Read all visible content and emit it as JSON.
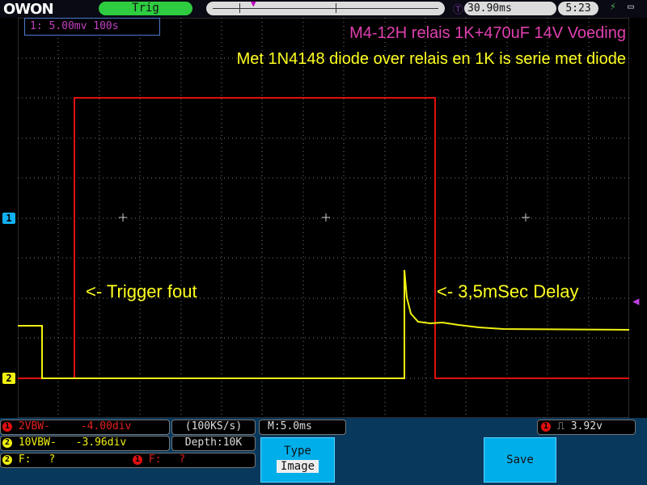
{
  "topbar": {
    "logo": "OWON",
    "trigger_state": "Trig",
    "trigger_time": "30.90ms",
    "clock": "5:23"
  },
  "info_box": "1: 5.00mv 100s",
  "notes": {
    "title": "M4-12H relais 1K+470uF 14V Voeding",
    "subtitle": "Met 1N4148 diode over relais en 1K is serie met diode"
  },
  "annotations": {
    "trigger_fout": "<- Trigger fout",
    "delay": "<- 3,5mSec Delay"
  },
  "channels": {
    "ch1_marker": "1",
    "ch2_marker": "2",
    "ch1_color": "#e01010",
    "ch2_color": "#f0f010"
  },
  "bottom": {
    "ch1_scale": "2VBW-",
    "ch1_offset": "-4.00div",
    "ch2_scale": "10VBW-",
    "ch2_offset": "-3.96div",
    "sample_rate": "(100KS/s)",
    "depth": "Depth:10K",
    "timebase": "M:5.0ms",
    "trigger_level": "3.92v",
    "ch2_freq_label": "F:",
    "ch2_freq_value": "?",
    "ch1_freq_label": "F:",
    "ch1_freq_value": "?",
    "type_label": "Type",
    "type_value": "Image",
    "save_label": "Save"
  }
}
